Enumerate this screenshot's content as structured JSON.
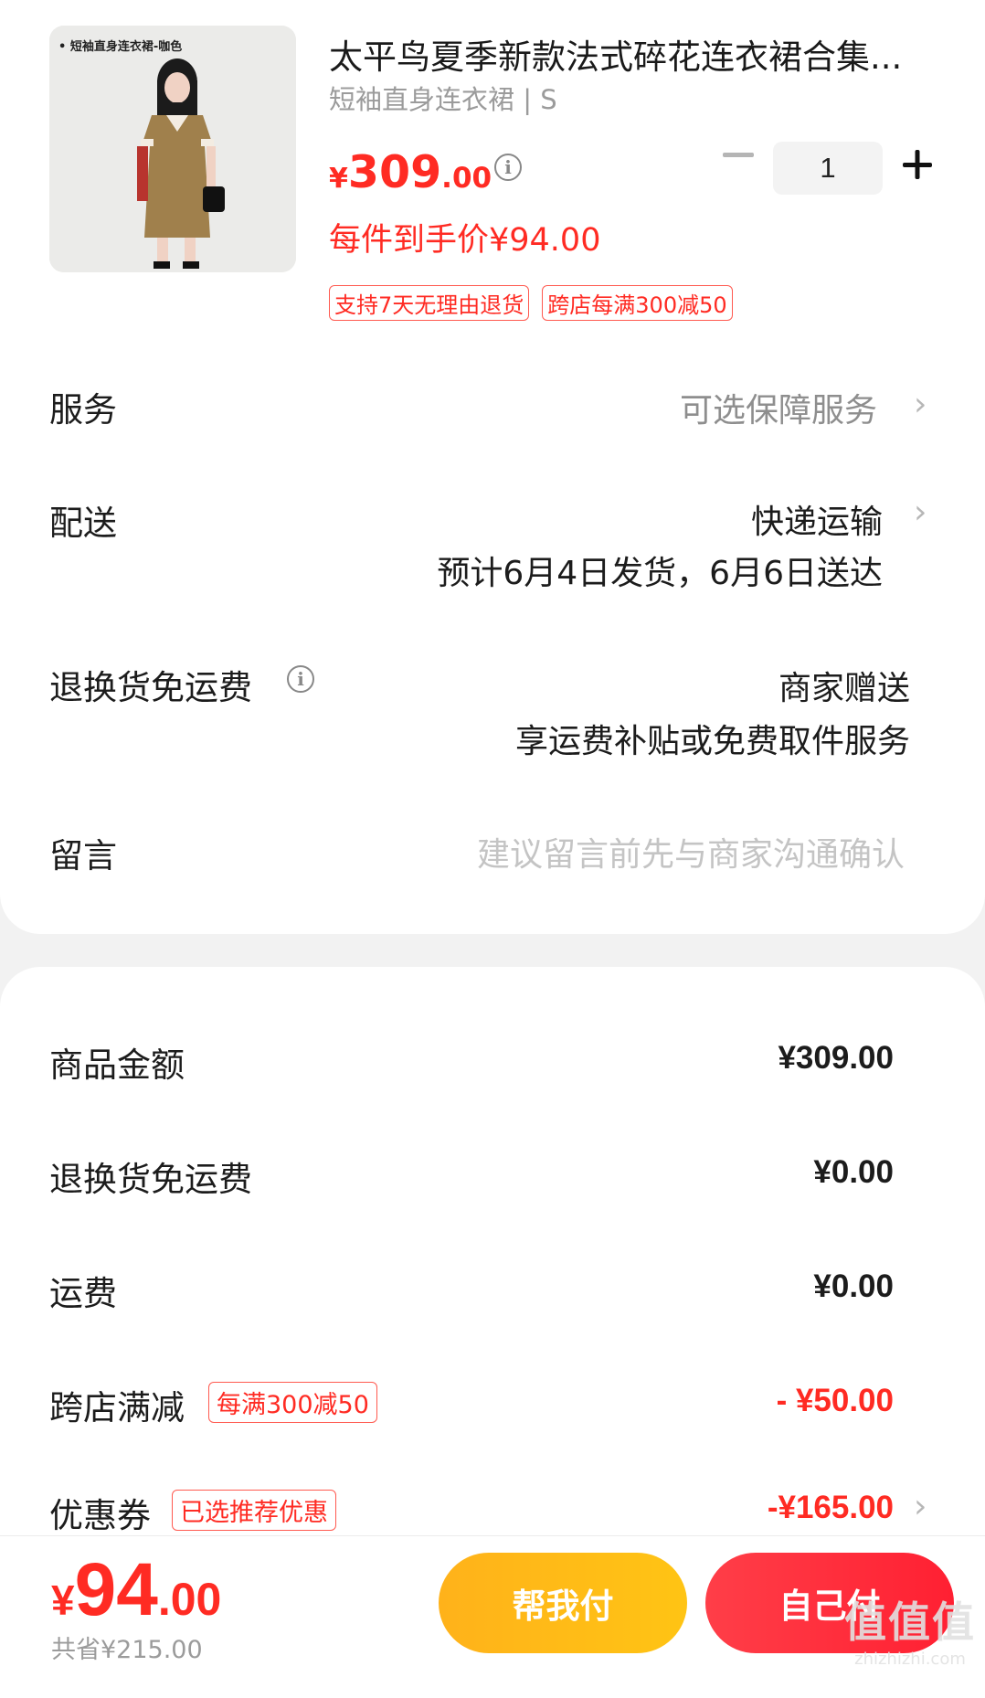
{
  "product": {
    "image_caption": "• 短袖直身连衣裙-咖色",
    "title": "太平鸟夏季新款法式碎花连衣裙合集...",
    "variant": "短袖直身连衣裙 | S",
    "price_currency": "¥",
    "price_int": "309",
    "price_dec": ".00",
    "quantity": "1",
    "hand_price": "每件到手价¥94.00",
    "tags": [
      "支持7天无理由退货",
      "跨店每满300减50"
    ]
  },
  "order_options": {
    "service_label": "服务",
    "service_value": "可选保障服务",
    "delivery_label": "配送",
    "delivery_method": "快递运输",
    "delivery_eta": "预计6月4日发货，6月6日送达",
    "return_label": "退换货免运费",
    "return_value": "商家赠送",
    "return_desc": "享运费补贴或免费取件服务",
    "message_label": "留言",
    "message_placeholder": "建议留言前先与商家沟通确认"
  },
  "summary": {
    "goods_label": "商品金额",
    "goods_value": "¥309.00",
    "return_fee_label": "退换货免运费",
    "return_fee_value": "¥0.00",
    "shipping_label": "运费",
    "shipping_value": "¥0.00",
    "crossstore_label": "跨店满减",
    "crossstore_tag": "每满300减50",
    "crossstore_value": "- ¥50.00",
    "coupon_label": "优惠券",
    "coupon_tag": "已选推荐优惠",
    "coupon_value": "-¥165.00"
  },
  "bottom": {
    "total_currency": "¥",
    "total_int": "94",
    "total_dec": ".00",
    "saved": "共省¥215.00",
    "help_pay_label": "帮我付",
    "self_pay_label": "自己付"
  },
  "watermark": {
    "big": "值值值",
    "small": "zhizhizhi.com"
  },
  "colors": {
    "accent_red": "#ff2b23",
    "help_button": "#ffb21a",
    "self_button": "#ff2032"
  },
  "icons": [
    "info-icon",
    "minus-icon",
    "plus-icon",
    "chevron-right-icon"
  ]
}
